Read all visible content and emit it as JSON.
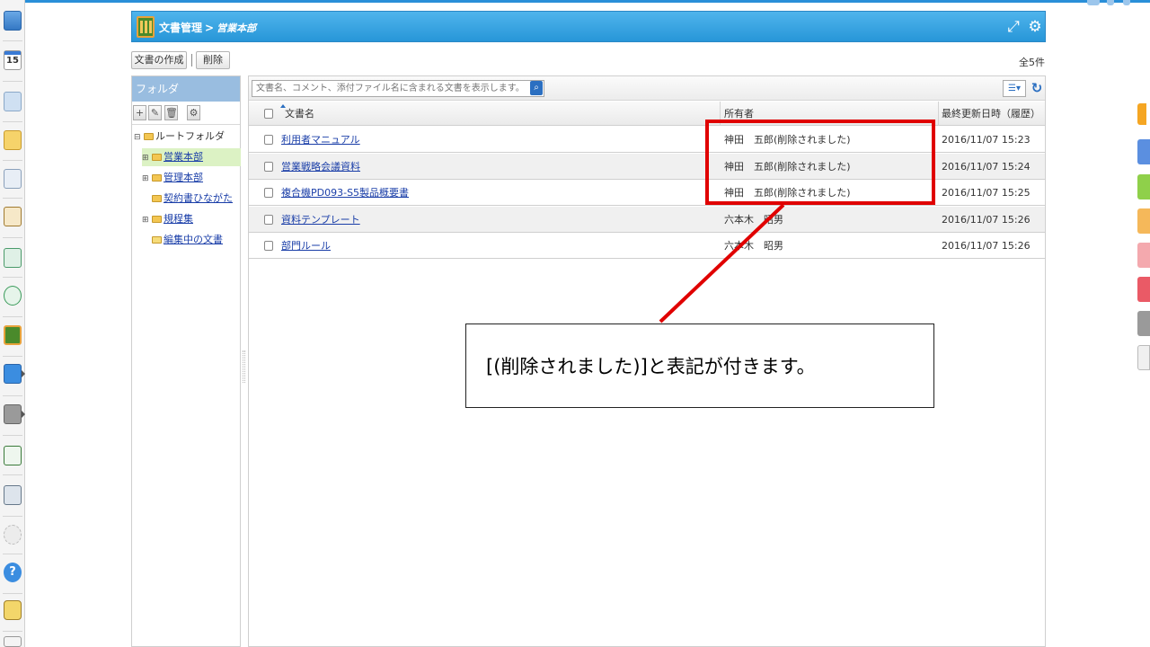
{
  "header": {
    "app_name": "文書管理",
    "separator": ">",
    "current_folder": "営業本部"
  },
  "toolbar": {
    "create_label": "文書の作成",
    "delete_label": "削除",
    "count_label": "全5件"
  },
  "folder_panel": {
    "title": "フォルダ",
    "tools": [
      "+",
      "✎",
      "🗑",
      "⚙"
    ],
    "root": "ルートフォルダ",
    "items": [
      {
        "label": "営業本部",
        "expander": "⊞",
        "selected": true
      },
      {
        "label": "管理本部",
        "expander": "⊞",
        "selected": false
      },
      {
        "label": "契約書ひながた",
        "expander": "",
        "selected": false
      },
      {
        "label": "規程集",
        "expander": "⊞",
        "selected": false
      },
      {
        "label": "編集中の文書",
        "expander": "",
        "selected": false
      }
    ]
  },
  "search": {
    "placeholder": "文書名、コメント、添付ファイル名に含まれる文書を表示します。"
  },
  "table": {
    "columns": [
      "文書名",
      "所有者",
      "最終更新日時（履歴）"
    ],
    "rows": [
      {
        "name": "利用者マニュアル",
        "owner": "神田　五郎(削除されました)",
        "updated": "2016/11/07 15:23"
      },
      {
        "name": "営業戦略会議資料",
        "owner": "神田　五郎(削除されました)",
        "updated": "2016/11/07 15:24"
      },
      {
        "name": "複合機PD093-S5製品概要書",
        "owner": "神田　五郎(削除されました)",
        "updated": "2016/11/07 15:25"
      },
      {
        "name": "資料テンプレート",
        "owner": "六本木　昭男",
        "updated": "2016/11/07 15:26"
      },
      {
        "name": "部門ルール",
        "owner": "六本木　昭男",
        "updated": "2016/11/07 15:26"
      }
    ]
  },
  "annotation": {
    "callout_text": "[(削除されました)]と表記が付きます。",
    "highlight_color": "#e00000"
  },
  "colors": {
    "header": "#2796d8",
    "folder_header": "#99bde0",
    "link": "#1a3ea8",
    "selected_folder": "#dcf2c4"
  }
}
